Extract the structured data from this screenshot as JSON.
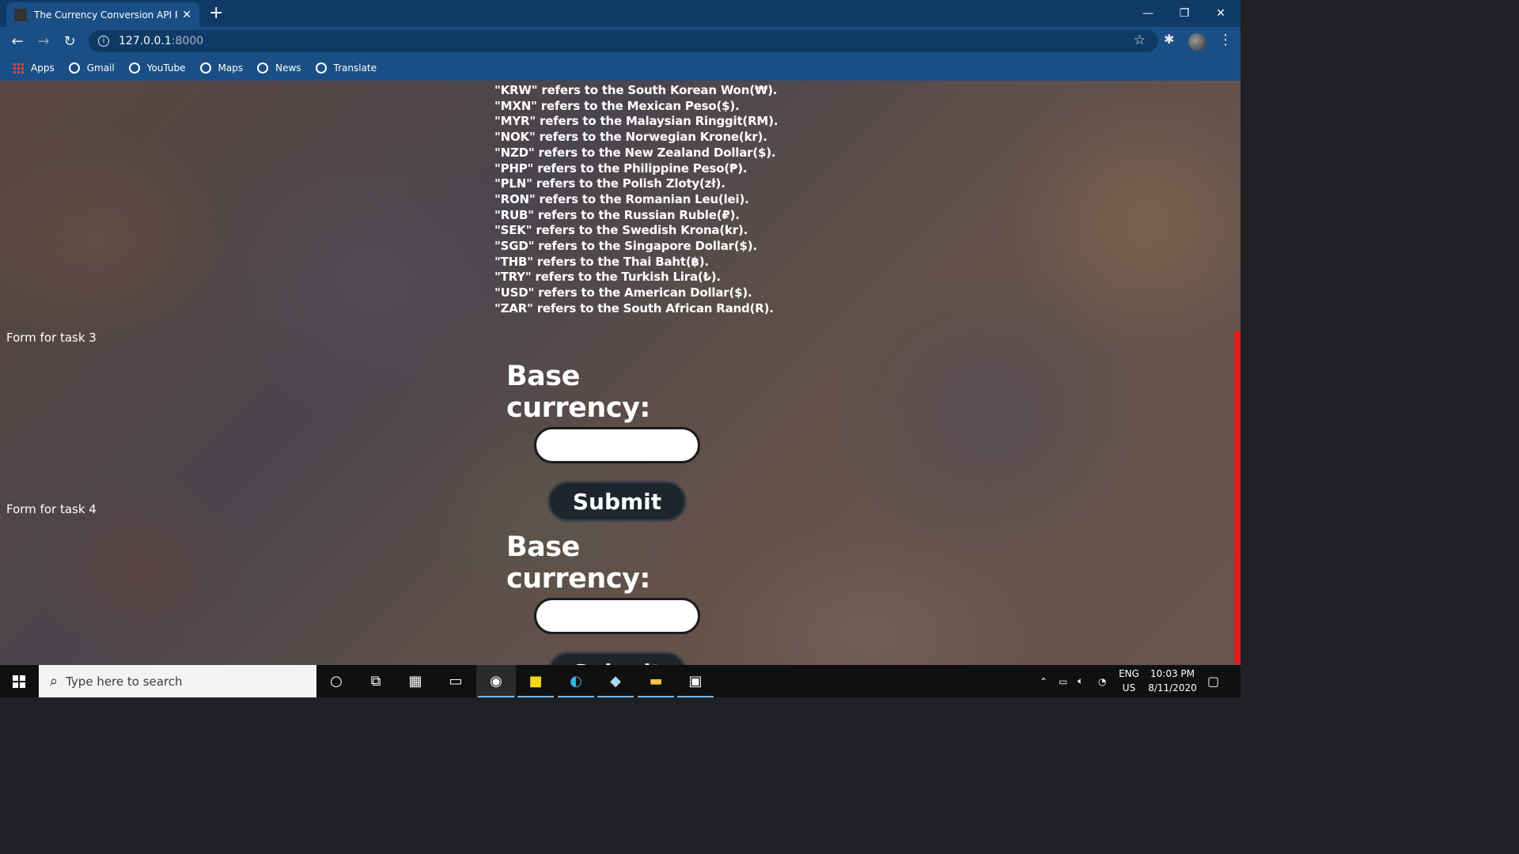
{
  "browser": {
    "tab_title": "The Currency Conversion API Pro",
    "new_tab": "+",
    "close_tab": "✕",
    "window": {
      "minimize": "—",
      "restore": "❐",
      "close": "✕"
    },
    "url_host": "127.0.0.1",
    "url_port": ":8000",
    "bookmarks": [
      {
        "label": "Apps",
        "icon": "apps-grid-icon"
      },
      {
        "label": "Gmail",
        "icon": "globe-icon"
      },
      {
        "label": "YouTube",
        "icon": "globe-icon"
      },
      {
        "label": "Maps",
        "icon": "globe-icon"
      },
      {
        "label": "News",
        "icon": "globe-icon"
      },
      {
        "label": "Translate",
        "icon": "globe-icon"
      }
    ]
  },
  "page": {
    "currency_list": [
      "\"KRW\" refers to the South Korean Won(₩).",
      "\"MXN\" refers to the Mexican Peso($).",
      "\"MYR\" refers to the Malaysian Ringgit(RM).",
      "\"NOK\" refers to the Norwegian Krone(kr).",
      "\"NZD\" refers to the New Zealand Dollar($).",
      "\"PHP\" refers to the Philippine Peso(₱).",
      "\"PLN\" refers to the Polish Zloty(zł).",
      "\"RON\" refers to the Romanian Leu(lei).",
      "\"RUB\" refers to the Russian Ruble(₽).",
      "\"SEK\" refers to the Swedish Krona(kr).",
      "\"SGD\" refers to the Singapore Dollar($).",
      "\"THB\" refers to the Thai Baht(฿).",
      "\"TRY\" refers to the Turkish Lira(₺).",
      "\"USD\" refers to the American Dollar($).",
      "\"ZAR\" refers to the South African Rand(R)."
    ],
    "task3": {
      "label": "Form for task 3",
      "field_label": "Base currency:",
      "input_value": "",
      "submit": "Submit"
    },
    "task4": {
      "label": "Form for task 4",
      "field_label": "Base currency:",
      "input_value": "",
      "submit": "Submit"
    }
  },
  "taskbar": {
    "search_placeholder": "Type here to search",
    "language": "ENG",
    "region": "US",
    "time": "10:03 PM",
    "date": "8/11/2020",
    "pinned": [
      "cortana-icon",
      "task-view-icon",
      "store-icon",
      "app-icon",
      "chrome-icon",
      "sticky-notes-icon",
      "edge-icon",
      "app-icon-2",
      "file-explorer-icon",
      "terminal-icon"
    ]
  },
  "colors": {
    "tab_bar": "#0f3a66",
    "toolbar": "#1a4f85",
    "scroll_thumb": "#e81a1a",
    "button_bg": "#1f252c"
  }
}
